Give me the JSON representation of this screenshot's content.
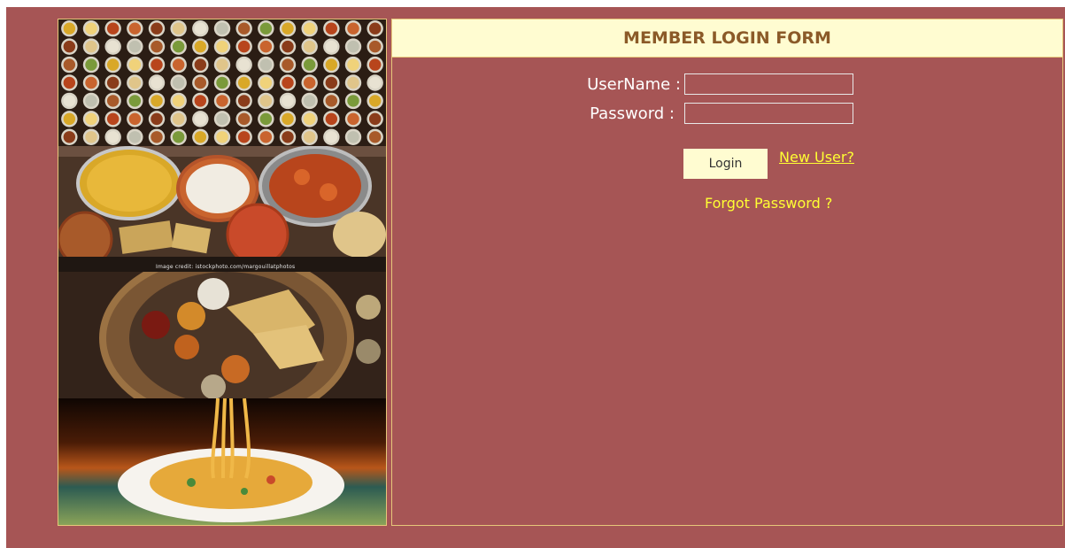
{
  "form": {
    "title": "MEMBER LOGIN FORM",
    "username_label": "UserName :",
    "username_value": "",
    "password_label": "Password :",
    "password_value": "",
    "login_button": "Login",
    "new_user_link": "New User?",
    "forgot_password_link": "Forgot Password ?"
  },
  "images": {
    "credit_text": "Image credit: istockphoto.com/margouillatphotos"
  },
  "colors": {
    "page_background": "#a65555",
    "header_background": "#fffcd1",
    "header_text": "#8b5a28",
    "link_color": "#ffff33",
    "border_color": "#e6c77a"
  }
}
